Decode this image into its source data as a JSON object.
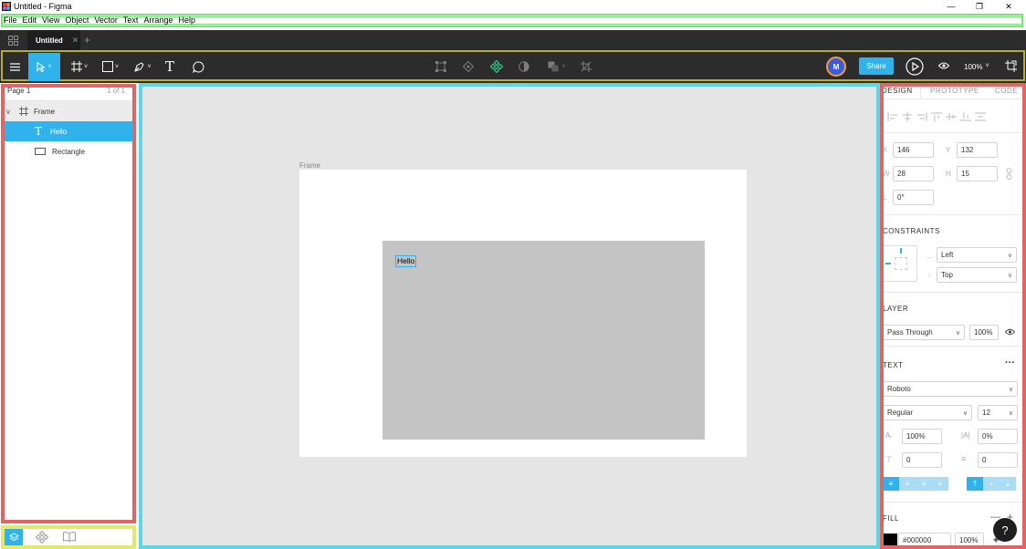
{
  "window": {
    "title": "Untitled - Figma"
  },
  "menu": [
    "File",
    "Edit",
    "View",
    "Object",
    "Vector",
    "Text",
    "Arrange",
    "Help"
  ],
  "tabs": [
    {
      "label": "Untitled"
    }
  ],
  "toolbar": {
    "avatar": "M",
    "share_label": "Share",
    "zoom": "100%"
  },
  "pages": {
    "current": "Page 1",
    "count": "1 of 1"
  },
  "layers": [
    {
      "name": "Frame",
      "type": "frame",
      "level": 0
    },
    {
      "name": "Hello",
      "type": "text",
      "level": 1,
      "selected": true
    },
    {
      "name": "Rectangle",
      "type": "rectangle",
      "level": 1
    }
  ],
  "canvas": {
    "frame_label": "Frame",
    "text_content": "Hello"
  },
  "design": {
    "tabs": [
      "DESIGN",
      "PROTOTYPE",
      "CODE"
    ],
    "x": "146",
    "y": "132",
    "w": "28",
    "h": "15",
    "rotation": "0°",
    "labels": {
      "x": "X",
      "y": "Y",
      "w": "W",
      "h": "H",
      "r": "L"
    },
    "constraints": {
      "title": "CONSTRAINTS",
      "horizontal": "Left",
      "vertical": "Top"
    },
    "layer": {
      "title": "LAYER",
      "blend": "Pass Through",
      "opacity": "100%"
    },
    "text": {
      "title": "TEXT",
      "font": "Roboto",
      "weight": "Regular",
      "size": "12",
      "line_height": "100%",
      "letter_spacing": "0%",
      "para_spacing": "0",
      "para_indent": "0"
    },
    "fill": {
      "title": "FILL",
      "color_hex": "#000000",
      "opacity": "100%"
    }
  },
  "help": {
    "label": "?"
  },
  "colors": {
    "accent": "#30b3ec",
    "dark": "#2c2c2c",
    "avatar_ring": "#f19d38",
    "avatar_fill": "#3b5bdb"
  }
}
